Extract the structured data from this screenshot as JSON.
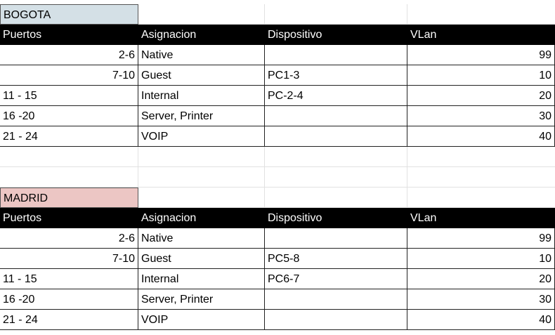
{
  "tables": [
    {
      "title": "BOGOTA",
      "title_color": "#d4e0e6",
      "headers": [
        "Puertos",
        "Asignacion",
        "Dispositivo",
        "VLan"
      ],
      "rows": [
        [
          "2-6",
          "Native",
          "",
          "99"
        ],
        [
          "7-10",
          "Guest",
          "PC1-3",
          "10"
        ],
        [
          "11 - 15",
          "Internal",
          "PC-2-4",
          "20"
        ],
        [
          "16 -20",
          "Server, Printer",
          "",
          "30"
        ],
        [
          "21 - 24",
          "VOIP",
          "",
          "40"
        ]
      ]
    },
    {
      "title": "MADRID",
      "title_color": "#ecc6c4",
      "headers": [
        "Puertos",
        "Asignacion",
        "Dispositivo",
        "VLan"
      ],
      "rows": [
        [
          "2-6",
          "Native",
          "",
          "99"
        ],
        [
          "7-10",
          "Guest",
          "PC5-8",
          "10"
        ],
        [
          "11 - 15",
          "Internal",
          "PC6-7",
          "20"
        ],
        [
          "16 -20",
          "Server, Printer",
          "",
          "30"
        ],
        [
          "21 - 24",
          "VOIP",
          "",
          "40"
        ]
      ]
    }
  ]
}
